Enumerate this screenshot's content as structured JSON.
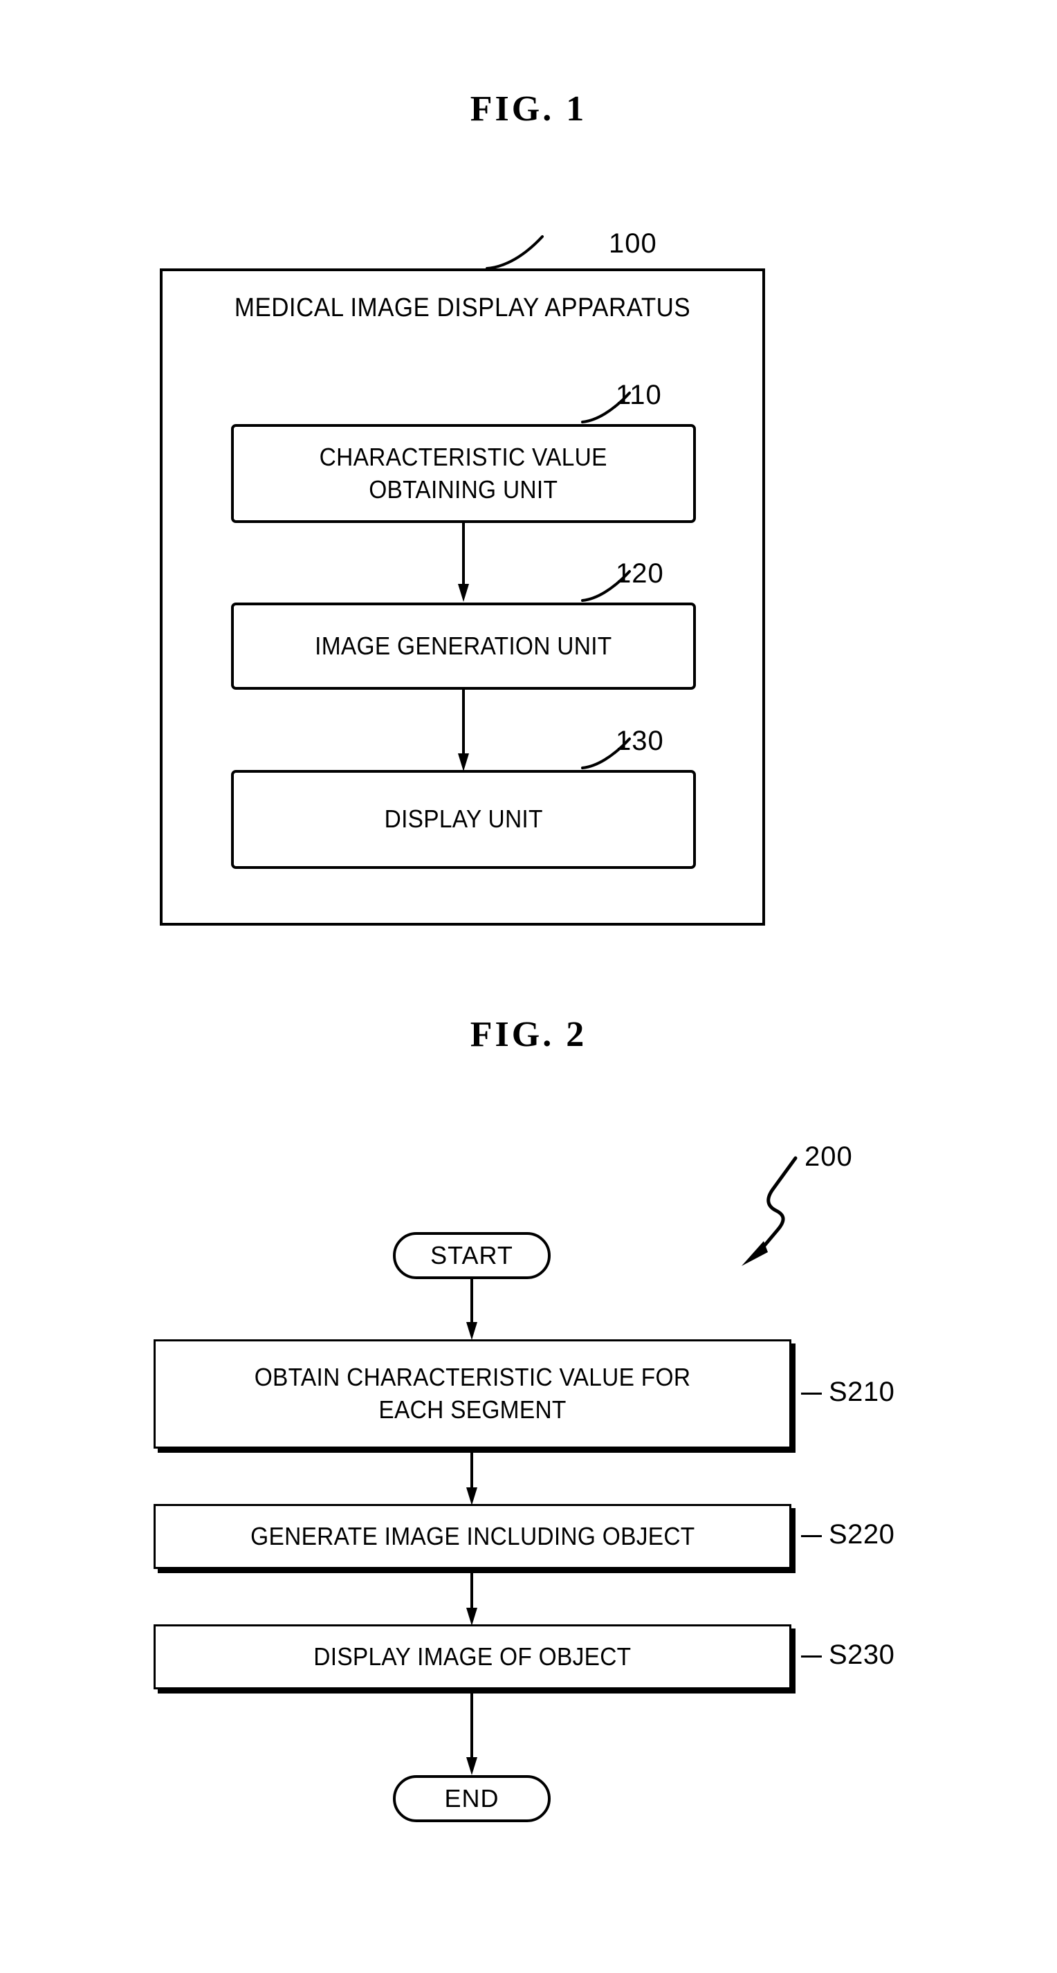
{
  "document": {
    "type": "patent-drawing-sheet"
  },
  "figures": [
    {
      "title": "FIG.  1",
      "reference": "100",
      "apparatus_title": "MEDICAL IMAGE DISPLAY APPARATUS",
      "blocks": [
        {
          "ref": "110",
          "label_line1": "CHARACTERISTIC VALUE",
          "label_line2": "OBTAINING UNIT"
        },
        {
          "ref": "120",
          "label_line1": "IMAGE GENERATION UNIT",
          "label_line2": ""
        },
        {
          "ref": "130",
          "label_line1": "DISPLAY UNIT",
          "label_line2": ""
        }
      ]
    },
    {
      "title": "FIG.  2",
      "reference": "200",
      "start_label": "START",
      "end_label": "END",
      "steps": [
        {
          "ref": "S210",
          "label_line1": "OBTAIN CHARACTERISTIC VALUE FOR",
          "label_line2": "EACH SEGMENT"
        },
        {
          "ref": "S220",
          "label_line1": "GENERATE IMAGE INCLUDING OBJECT",
          "label_line2": ""
        },
        {
          "ref": "S230",
          "label_line1": "DISPLAY IMAGE OF OBJECT",
          "label_line2": ""
        }
      ]
    }
  ],
  "colors": {
    "ink": "#000000",
    "paper": "#ffffff"
  }
}
